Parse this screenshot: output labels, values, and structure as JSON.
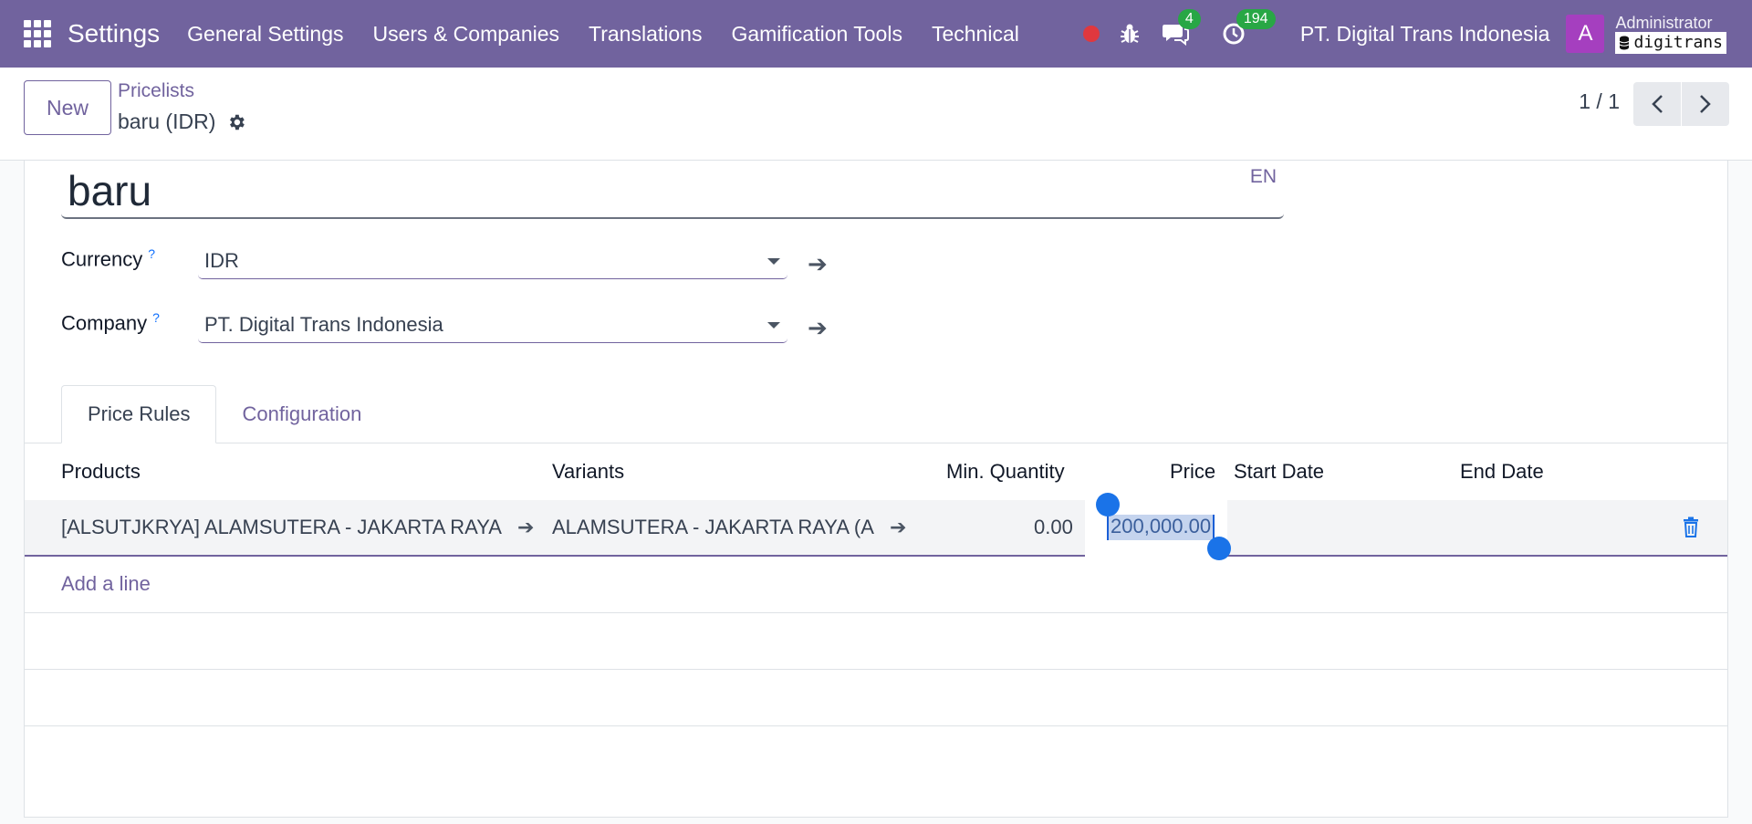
{
  "navbar": {
    "app_title": "Settings",
    "menu": [
      "General Settings",
      "Users & Companies",
      "Translations",
      "Gamification Tools",
      "Technical"
    ],
    "messages_count": "4",
    "activities_count": "194",
    "company": "PT. Digital Trans Indonesia",
    "avatar_letter": "A",
    "user_name": "Administrator",
    "database": "digitrans",
    "brand_color": "#71639e"
  },
  "control": {
    "new_label": "New",
    "breadcrumb": "Pricelists",
    "record_title": "baru (IDR)",
    "pager": "1 / 1"
  },
  "form": {
    "name": "baru",
    "lang": "EN",
    "currency_label": "Currency",
    "currency_value": "IDR",
    "company_label": "Company",
    "company_value": "PT. Digital Trans Indonesia",
    "help_mark": "?"
  },
  "tabs": [
    "Price Rules",
    "Configuration"
  ],
  "table": {
    "headers": {
      "products": "Products",
      "variants": "Variants",
      "min_qty": "Min. Quantity",
      "price": "Price",
      "start_date": "Start Date",
      "end_date": "End Date"
    },
    "row": {
      "product": "[ALSUTJKRYA] ALAMSUTERA - JAKARTA RAYA",
      "variant": "ALAMSUTERA - JAKARTA RAYA (A",
      "min_qty": "0.00",
      "price": "200,000.00",
      "start_date": "",
      "end_date": ""
    },
    "add_line": "Add a line"
  }
}
